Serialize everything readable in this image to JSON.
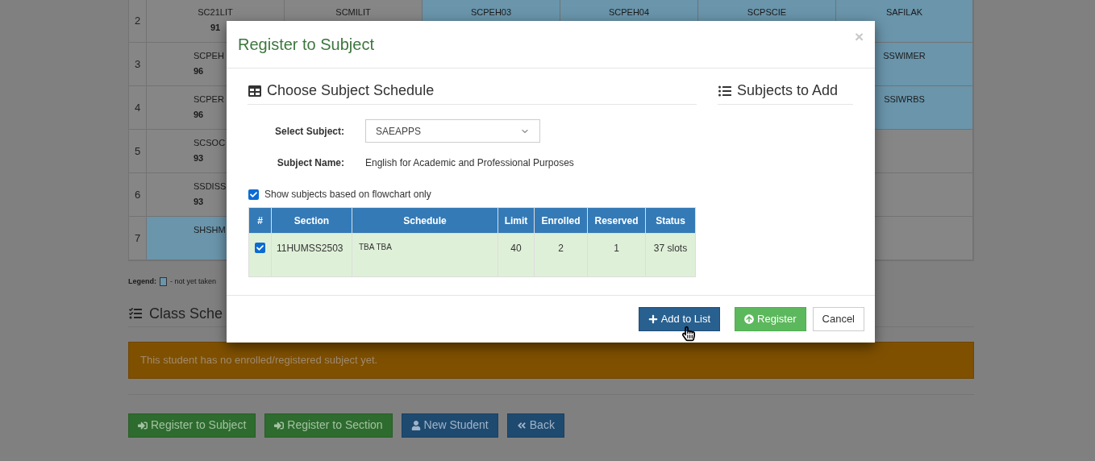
{
  "schedule_grid": {
    "rows": [
      {
        "number": "2",
        "cells": [
          {
            "code": "SC21LIT",
            "grade": "91",
            "taken": true
          },
          {
            "code": "SCMILIT",
            "taken": true
          },
          {
            "code": "SCPEH03",
            "taken": false
          },
          {
            "code": "SCPEH04",
            "taken": false
          },
          {
            "code": "SCPSCIE",
            "taken": false
          },
          {
            "code": "SAFILAK",
            "taken": false
          }
        ]
      },
      {
        "number": "3",
        "cells": [
          {
            "code": "SCPEH",
            "grade": "96",
            "taken": true
          },
          {
            "code": "SSWIMER",
            "taken": false
          }
        ]
      },
      {
        "number": "4",
        "cells": [
          {
            "code": "SCPER",
            "grade": "96",
            "taken": true
          },
          {
            "code": "SSIWRBS",
            "taken": false
          }
        ]
      },
      {
        "number": "5",
        "cells": [
          {
            "code": "SCSOC",
            "grade": "93",
            "taken": true
          },
          {
            "taken": true
          }
        ]
      },
      {
        "number": "6",
        "cells": [
          {
            "code": "SSDISS",
            "grade": "93",
            "taken": true
          },
          {
            "taken": true
          }
        ]
      },
      {
        "number": "7",
        "cells": [
          {
            "code": "SHSHM",
            "taken": false
          },
          {
            "taken": true
          }
        ]
      }
    ]
  },
  "legend": {
    "label": "Legend:",
    "item": "- not yet taken"
  },
  "class_schedule": {
    "heading": "Class Sche",
    "alert": "This student has no enrolled/registered subject yet."
  },
  "page_buttons": [
    {
      "label": "Register to Subject",
      "kind": "signin-green"
    },
    {
      "label": "Register to Section",
      "kind": "signin-green"
    },
    {
      "label": "New Student",
      "kind": "user-blue"
    },
    {
      "label": "Back",
      "kind": "back-blue"
    }
  ],
  "modal": {
    "title": "Register to Subject",
    "close": "×",
    "left_heading": "Choose Subject Schedule",
    "right_heading": "Subjects to Add",
    "select_label": "Select Subject:",
    "select_value": "SAEAPPS",
    "name_label": "Subject Name:",
    "name_value": "English for Academic and Professional Purposes",
    "flowchart": {
      "label": "Show subjects based on flowchart only",
      "checked": true
    },
    "table": {
      "columns": [
        "#",
        "Section",
        "Schedule",
        "Limit",
        "Enrolled",
        "Reserved",
        "Status"
      ],
      "rows": [
        {
          "checked": true,
          "section": "11HUMSS2503",
          "schedule": "TBA TBA",
          "limit": "40",
          "enrolled": "2",
          "reserved": "1",
          "status": "37 slots"
        }
      ]
    },
    "buttons": [
      {
        "label": "Add to List",
        "kind": "add"
      },
      {
        "label": "Register",
        "kind": "register"
      },
      {
        "label": "Cancel",
        "kind": "cancel"
      }
    ]
  }
}
